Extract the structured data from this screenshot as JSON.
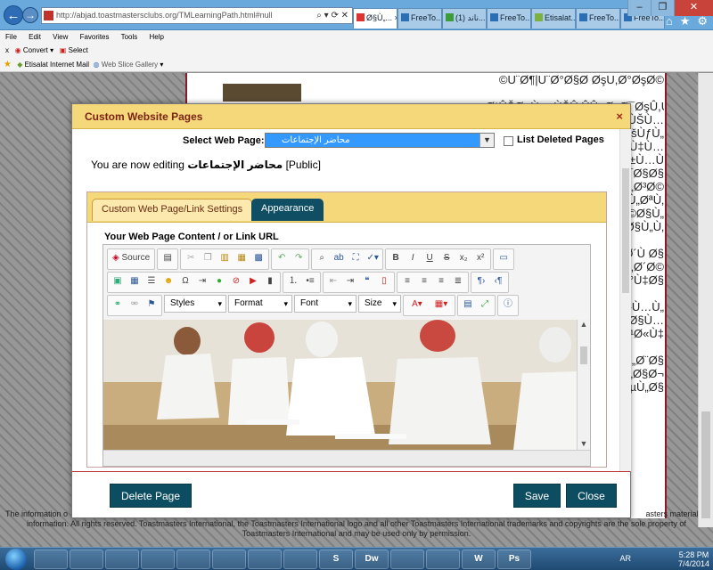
{
  "browser": {
    "url": "http://abjad.toastmastersclubs.org/TMLearningPath.html#null",
    "tabs": [
      "Ø§Ù„...",
      "FreeTo...",
      "(1) ناند...",
      "FreeTo...",
      "Etisalat...",
      "FreeTo...",
      "FreeTo..."
    ],
    "tab_close": "×",
    "menu": [
      "File",
      "Edit",
      "View",
      "Favorites",
      "Tools",
      "Help"
    ],
    "command_bar": {
      "close": "x",
      "convert": "Convert",
      "select": "Select"
    },
    "favorites": {
      "etisalat": "Etisalat Internet Mail",
      "web_slice": "Web Slice Gallery"
    }
  },
  "background_page": {
    "garbled_lines": [
      "©U¨Ø¶|U¨Ø°Ø§Ø ØşU,Ø°ØşØ©",
      "",
      "Ø¹ÛŠØ¬Ù… ÙŠÛ,ÛÛ¤ØşØ¯ØşÛ,Ù...",
      "Ø°Ù† ØºØ±ÙŠÙ…",
      "ÙŠÙÙ„Ù…ØªÙŠØšÙƒÙ„",
      "Ø§Ø¬ØªÙ…Ø§Ø¹Ø§ØªÙ‡Ù…",
      "Ø¹Ù‡Ø¯ØªØ±Ù…Ù",
      "Ø³ÙŠÙÙ‡Ø¯Ø§Ø§",
      "Ø§Ù„Ø¬Ù„Ø³Ø©",
      "Ø¨Ø§Ù„Ù…Ø§Ù„ØªÙ‚",
      "Ø°Ù†ÙŠØ©Ø§Ù„",
      "Ù„Ø¬Ù†ÙŠÙ‡ÙˆØ§Ù„Ù‚",
      "",
      "Ø³ÙŠÙƒØªØ´Ù Ø§",
      "Ø¨Ø§Ù„Ù…Ù†Ø§Ù‚Ø´Ø©",
      "Ø¢ÙˆØ¨Ø§Ù„Ø°Ù‡Ø§",
      "",
      "Ù„Ø§ØªØ¹Ù…Ù„",
      "Ù„Ø¬Ù…ÙŠØ¹Ù„Ø§Ù…",
      "Ø§Ø§Ù„Ø§Ø·Ù„Ø§Ø¹Ø«Ù‡",
      "",
      "Ø¬Ù…ÙŠØ¹Ø§Ù„Ø¨Ø§",
      "Ø§Ø«Ù†Ø§Ø¡Ø§Ù„Ø§Ø¬",
      "Ù„Ù„ØªÙˆØ§ØµÙ„Ø§"
    ],
    "footer_left": "The information o",
    "footer_right": "asters material or",
    "footer_line2": "information. All rights reserved. Toastmasters International, the Toastmasters International logo and all other Toastmasters International trademarks and copyrights are the sole property of",
    "footer_line3": "Toastmasters International and may be used only by permission."
  },
  "dialog": {
    "title": "Custom Website Pages",
    "close": "×",
    "select_label": "Select Web Page:",
    "selected_page": "محاضر الإجتماعات",
    "list_deleted_label": "List Deleted Pages",
    "editing_prefix": "You are now editing",
    "editing_page": "محاضر الإجتماعات",
    "editing_suffix": "[Public]",
    "tabs": [
      "Custom Web Page/Link Settings",
      "Appearance"
    ],
    "content_label": "Your Web Page Content / or Link URL",
    "editor": {
      "source": "Source",
      "styles": "Styles",
      "format": "Format",
      "font": "Font",
      "size": "Size"
    },
    "buttons": {
      "delete": "Delete Page",
      "save": "Save",
      "close": "Close"
    }
  },
  "taskbar": {
    "lang": "AR",
    "time": "5:28 PM",
    "date": "7/4/2014",
    "apps": [
      "",
      "",
      "",
      "",
      "",
      "",
      "",
      "",
      "S",
      "Dw",
      "",
      "",
      "W",
      "Ps"
    ]
  },
  "colors": {
    "dialog_header": "#f5d87a",
    "title_text": "#7a2416",
    "button": "#0d4d61",
    "selection": "#3399ff"
  }
}
